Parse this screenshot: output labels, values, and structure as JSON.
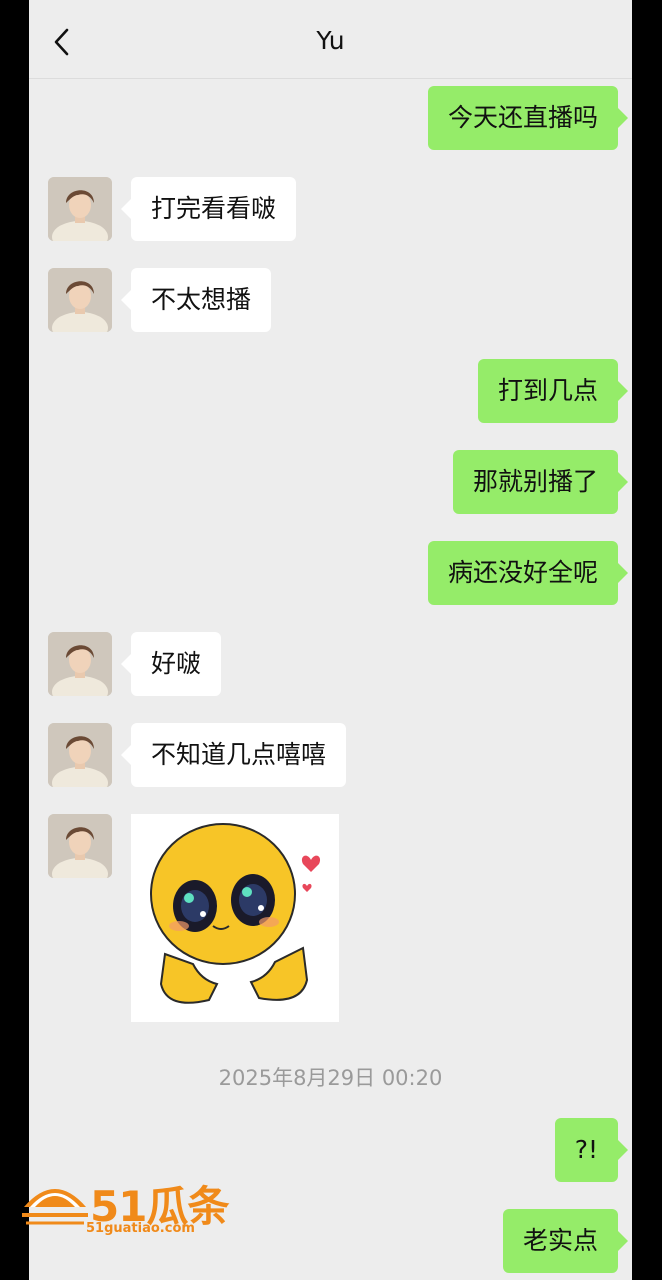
{
  "header": {
    "title": "Yu"
  },
  "messages": [
    {
      "side": "out",
      "text": "今天还直播吗"
    },
    {
      "side": "in",
      "text": "打完看看啵"
    },
    {
      "side": "in",
      "text": "不太想播"
    },
    {
      "side": "out",
      "text": "打到几点"
    },
    {
      "side": "out",
      "text": "那就别播了"
    },
    {
      "side": "out",
      "text": "病还没好全呢"
    },
    {
      "side": "in",
      "text": "好啵"
    },
    {
      "side": "in",
      "text": "不知道几点嘻嘻"
    },
    {
      "side": "in",
      "type": "sticker",
      "sticker": "crying-cute-emoji-sticker"
    },
    {
      "side": "out",
      "text": "?!"
    },
    {
      "side": "out",
      "text": "老实点"
    }
  ],
  "timestamp": "2025年8月29日 00:20",
  "watermark": {
    "brand": "51瓜条",
    "url": "51guatiao.com"
  },
  "colors": {
    "outgoing": "#95ec69",
    "incoming": "#ffffff",
    "background": "#ededed",
    "watermark": "#f08a1a"
  }
}
